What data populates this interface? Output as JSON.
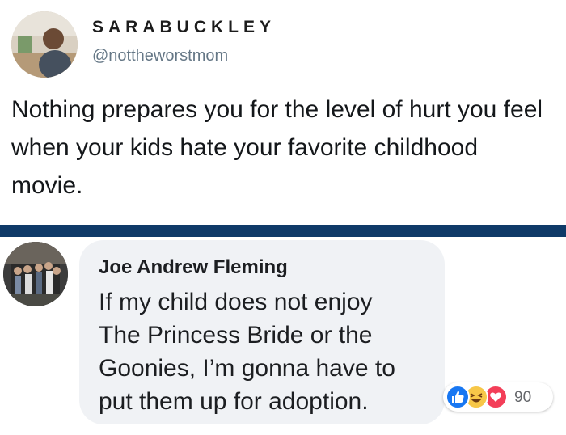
{
  "tweet": {
    "display_name": "SARABUCKLEY",
    "handle": "@nottheworstmom",
    "text": "Nothing prepares you for the level of hurt you feel when your kids hate your favorite childhood movie."
  },
  "comment": {
    "author": "Joe Andrew Fleming",
    "text_lines": [
      "If my child does not enjoy",
      "The Princess Bride or the",
      "Goonies, I’m gonna have to",
      "put them up for adoption."
    ],
    "reactions": {
      "icons": [
        "like-icon",
        "haha-icon",
        "love-icon"
      ],
      "count": "90"
    }
  },
  "colors": {
    "divider": "#0f3a68",
    "bubble": "#f0f2f5",
    "like": "#1877f2",
    "haha": "#f7c748",
    "love": "#f33e58"
  }
}
